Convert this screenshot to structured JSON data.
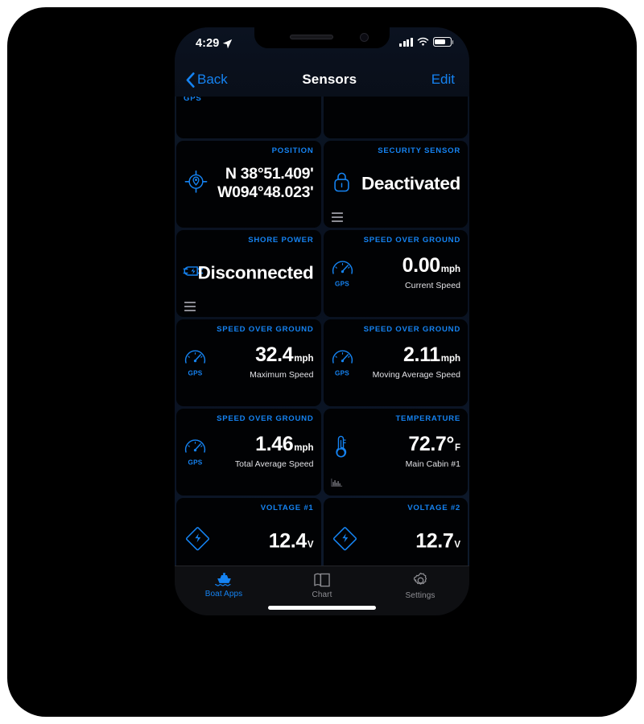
{
  "status_bar": {
    "time": "4:29",
    "location_icon": "location-arrow-icon",
    "signal_icon": "cellular-signal-icon",
    "wifi_icon": "wifi-icon",
    "battery_icon": "battery-icon"
  },
  "nav_bar": {
    "back_label": "Back",
    "title": "Sensors",
    "edit_label": "Edit"
  },
  "cards": [
    {
      "id": "gps-partial-left",
      "title": "GPS",
      "partial": true
    },
    {
      "id": "partial-right",
      "title": "",
      "partial": true
    },
    {
      "id": "position",
      "title": "POSITION",
      "icon": "location-crosshair-icon",
      "coord_line1": "N 38°51.409'",
      "coord_line2": "W094°48.023'"
    },
    {
      "id": "security-sensor",
      "title": "SECURITY SENSOR",
      "icon": "lock-icon",
      "value": "Deactivated",
      "drag_handle": true
    },
    {
      "id": "shore-power",
      "title": "SHORE POWER",
      "icon": "power-plug-icon",
      "value": "Disconnected",
      "drag_handle": true
    },
    {
      "id": "speed-current",
      "title": "SPEED OVER GROUND",
      "icon": "gps-gauge-icon",
      "icon_label": "GPS",
      "value": "0.00",
      "unit": "mph",
      "sub": "Current Speed"
    },
    {
      "id": "speed-maximum",
      "title": "SPEED OVER GROUND",
      "icon": "gps-gauge-icon",
      "icon_label": "GPS",
      "value": "32.4",
      "unit": "mph",
      "sub": "Maximum Speed"
    },
    {
      "id": "speed-moving-average",
      "title": "SPEED OVER GROUND",
      "icon": "gps-gauge-icon",
      "icon_label": "GPS",
      "value": "2.11",
      "unit": "mph",
      "sub": "Moving Average Speed"
    },
    {
      "id": "speed-total-average",
      "title": "SPEED OVER GROUND",
      "icon": "gps-gauge-icon",
      "icon_label": "GPS",
      "value": "1.46",
      "unit": "mph",
      "sub": "Total Average Speed"
    },
    {
      "id": "temperature",
      "title": "TEMPERATURE",
      "icon": "thermometer-icon",
      "value": "72.7°",
      "unit": "F",
      "sub": "Main Cabin #1",
      "sparkline": true
    },
    {
      "id": "voltage-1",
      "title": "VOLTAGE #1",
      "icon": "voltage-diamond-icon",
      "value": "12.4",
      "unit": "V",
      "sparkline": true
    },
    {
      "id": "voltage-2",
      "title": "VOLTAGE #2",
      "icon": "voltage-diamond-icon",
      "value": "12.7",
      "unit": "V",
      "sparkline": true
    }
  ],
  "tab_bar": {
    "tabs": [
      {
        "label": "Boat Apps",
        "icon": "boat-icon",
        "active": true
      },
      {
        "label": "Chart",
        "icon": "chart-map-icon",
        "active": false
      },
      {
        "label": "Settings",
        "icon": "gear-icon",
        "active": false
      }
    ]
  },
  "colors": {
    "accent": "#1583f2",
    "card_bg": "#010204",
    "screen_bg": "#0a1322",
    "inactive": "#8e8e93"
  }
}
